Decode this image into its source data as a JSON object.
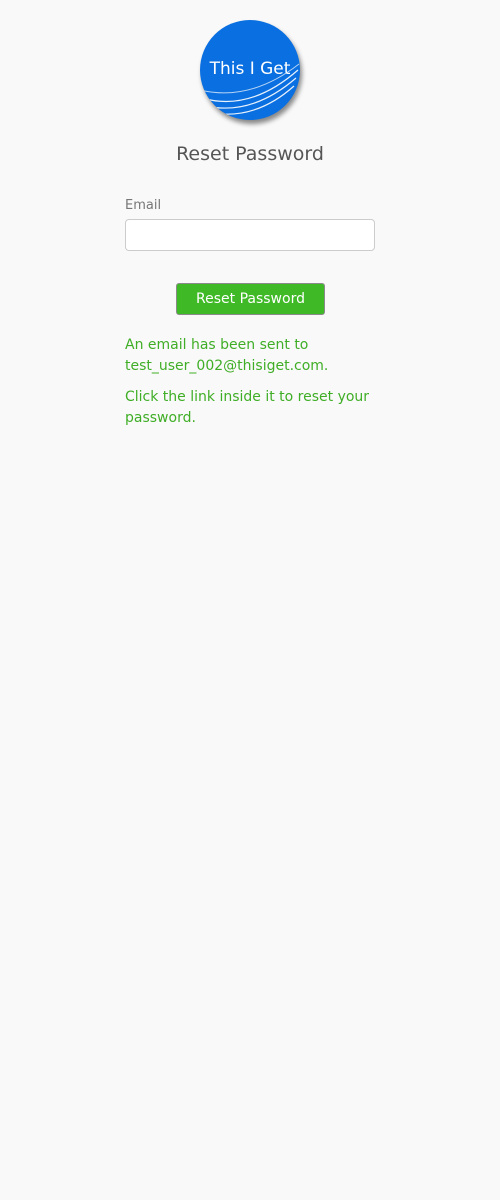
{
  "logo": {
    "text": "This I Get"
  },
  "page": {
    "title": "Reset Password"
  },
  "form": {
    "email_label": "Email",
    "email_value": "",
    "email_placeholder": "",
    "submit_label": "Reset Password"
  },
  "messages": {
    "line1_prefix": "An email has been sent to",
    "line1_email": "test_user_002@thisiget.com.",
    "line2": "Click the link inside it to reset your password."
  },
  "colors": {
    "background": "#f9f9f9",
    "logo_blue": "#0a6fe0",
    "accent_green": "#3fba26",
    "message_green": "#3fae26"
  }
}
